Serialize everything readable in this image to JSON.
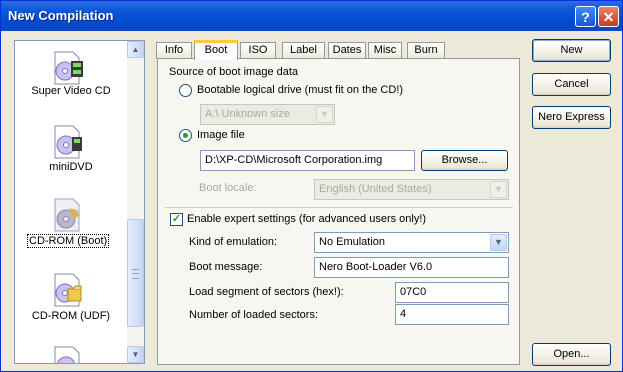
{
  "window": {
    "title": "New Compilation"
  },
  "titlebar": {
    "help_glyph": "?",
    "close_glyph": "✕"
  },
  "compilation_list": {
    "items": [
      {
        "label": "Super Video CD",
        "icon": "super-video-cd-icon",
        "selected": false
      },
      {
        "label": "miniDVD",
        "icon": "minidvd-icon",
        "selected": false
      },
      {
        "label": "CD-ROM (Boot)",
        "icon": "cd-rom-boot-icon",
        "selected": true
      },
      {
        "label": "CD-ROM (UDF)",
        "icon": "cd-rom-udf-icon",
        "selected": false
      },
      {
        "label": "",
        "icon": "disc-icon",
        "selected": false
      }
    ]
  },
  "tabs": [
    "Info",
    "Boot",
    "ISO",
    "Label",
    "Dates",
    "Misc",
    "Burn"
  ],
  "active_tab": "Boot",
  "boot": {
    "source_heading": "Source of boot image data",
    "bootable_drive_label": "Bootable logical drive (must fit on the CD!)",
    "drive_select_value": "A:\\  Unknown size",
    "image_file_label": "Image file",
    "image_file_value": "D:\\XP-CD\\Microsoft Corporation.img",
    "browse_label": "Browse...",
    "boot_locale_label": "Boot locale:",
    "boot_locale_value": "English (United States)",
    "expert_label": "Enable expert settings (for advanced users only!)",
    "kind_of_emulation_label": "Kind of emulation:",
    "kind_of_emulation_value": "No Emulation",
    "boot_message_label": "Boot message:",
    "boot_message_value": "Nero Boot-Loader V6.0",
    "load_segment_label": "Load segment of sectors (hex!):",
    "load_segment_value": "07C0",
    "num_sectors_label": "Number of loaded sectors:",
    "num_sectors_value": "4"
  },
  "buttons": {
    "new": "New",
    "cancel": "Cancel",
    "nero_express": "Nero Express",
    "open": "Open..."
  },
  "colors": {
    "titlebar": "#0a5ad8",
    "window_bg": "#ece9d8",
    "tab_highlight": "#ffc83c"
  }
}
